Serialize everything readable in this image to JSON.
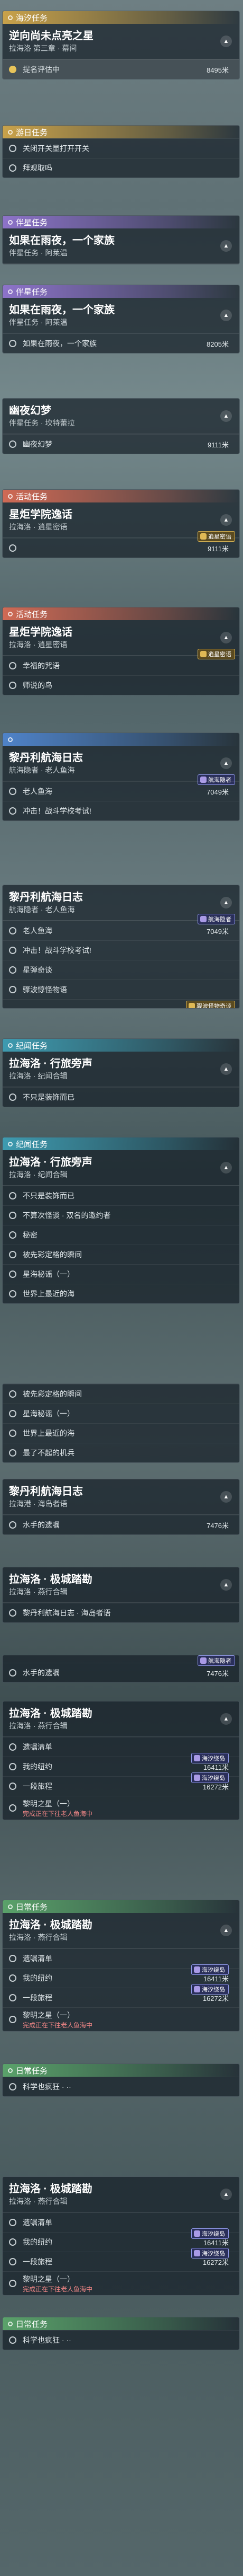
{
  "groups": [
    {
      "header": "海汐任务",
      "color": "yellow",
      "quest": {
        "title": "逆向尚未点亮之星",
        "subtitle": "拉海洛 第三章 · 幕间"
      },
      "rows": [
        {
          "text": "提名评估中",
          "distance": "8495米",
          "active": true,
          "checked": true
        }
      ]
    },
    {
      "header": "游日任务",
      "color": "yellow",
      "rows": [
        {
          "text": "关闭开关显打开开关"
        },
        {
          "text": "拜观取吗"
        }
      ]
    },
    {
      "header": "伴星任务",
      "color": "purple",
      "quest": {
        "title": "如果在雨夜，一个家族",
        "subtitle": "伴星任务 · 阿莱温"
      },
      "rows": []
    },
    {
      "header": "伴星任务",
      "color": "purple",
      "quest": {
        "title": "如果在雨夜，一个家族",
        "subtitle": "伴星任务 · 阿莱温"
      },
      "rows": [
        {
          "text": "如果在雨夜，一个家族",
          "distance": "8205米"
        }
      ]
    },
    {
      "quest": {
        "title": "幽夜幻梦",
        "subtitle": "伴星任务 · 坎特蕾拉"
      },
      "rows": [
        {
          "text": "幽夜幻梦",
          "distance": "9111米"
        }
      ]
    },
    {
      "header": "活动任务",
      "color": "red",
      "quest": {
        "title": "星炬学院逸话",
        "subtitle": "拉海洛 · 逍星密语"
      },
      "badge": {
        "text": "逍星密语",
        "style": "yellow"
      },
      "rows": [
        {
          "text": "",
          "distance": "9111米"
        }
      ]
    },
    {
      "header": "活动任务",
      "color": "red",
      "quest": {
        "title": "星炬学院逸话",
        "subtitle": "拉海洛 · 逍星密语"
      },
      "badge": {
        "text": "逍星密语",
        "style": "yellow"
      },
      "rows": [
        {
          "text": "幸福的咒语"
        },
        {
          "text": "师说的鸟"
        }
      ]
    },
    {
      "header": "",
      "color": "blue",
      "quest": {
        "title": "黎丹利航海日志",
        "subtitle": "航海隐者 · 老人鱼海"
      },
      "badge": {
        "text": "航海隐者",
        "style": "purple"
      },
      "rows": [
        {
          "text": "老人鱼海",
          "distance": "7049米"
        },
        {
          "text": "冲击！战斗学校考试!"
        }
      ]
    },
    {
      "quest": {
        "title": "黎丹利航海日志",
        "subtitle": "航海隐者 · 老人鱼海"
      },
      "badge": {
        "text": "航海隐者",
        "style": "purple"
      },
      "rows": [
        {
          "text": "老人鱼海",
          "distance": "7049米"
        },
        {
          "text": "冲击！战斗学校考试!"
        },
        {
          "text": "星弹奇谈"
        },
        {
          "text": "骤波惊怪物语"
        }
      ],
      "badge2": {
        "text": "骤波怪物奇谈",
        "style": "yellow"
      }
    },
    {
      "header": "纪闻任务",
      "color": "teal",
      "quest": {
        "title": "拉海洛 · 行旅旁声",
        "subtitle": "拉海洛 · 纪闻合辑"
      },
      "rows": [
        {
          "text": "不只是装饰而已"
        }
      ]
    },
    {
      "header": "纪闻任务",
      "color": "teal",
      "quest": {
        "title": "拉海洛 · 行旅旁声",
        "subtitle": "拉海洛 · 纪闻合辑"
      },
      "rows": [
        {
          "text": "不只是装饰而已"
        },
        {
          "text": "不算次怪谈 · 双名的邀约者"
        },
        {
          "text": "秘密"
        },
        {
          "text": "被先彩定格的瞬间"
        },
        {
          "text": "星海秘谣（一）"
        },
        {
          "text": "世界上最近的海"
        }
      ]
    },
    {
      "rows": [
        {
          "text": "被先彩定格的瞬间"
        },
        {
          "text": "星海秘谣（一）"
        },
        {
          "text": "世界上最近的海"
        },
        {
          "text": "最了不起的机兵"
        }
      ]
    },
    {
      "quest": {
        "title": "黎丹利航海日志",
        "subtitle": "拉海港 · 海岛者语"
      },
      "rows": [
        {
          "text": "水手的遗嘱",
          "distance": "7476米"
        }
      ]
    },
    {
      "quest": {
        "title": "拉海洛 · 极城踏勘",
        "subtitle": "拉海洛 · 燕行合辑"
      },
      "rows": [
        {
          "text": "黎丹利航海日志 · 海岛者语"
        }
      ]
    },
    {
      "badge": {
        "text": "航海隐者",
        "style": "purple"
      },
      "rows": [
        {
          "text": "水手的遗嘱",
          "distance": "7476米"
        }
      ]
    },
    {
      "quest": {
        "title": "拉海洛 · 极城踏勘",
        "subtitle": "拉海洛 · 燕行合辑"
      },
      "rows": [
        {
          "text": "遗嘱清单"
        },
        {
          "text": "我的纽约",
          "distance": "16411米",
          "badge": "海汐绕岛"
        },
        {
          "text": "一段旅程",
          "distance": "16272米",
          "badge": "海汐绕岛"
        },
        {
          "text": "黎明之星（一）",
          "warn": "完成正在下往老人鱼海中",
          "tall": true
        }
      ]
    },
    {
      "header": "日常任务",
      "color": "green",
      "quest": {
        "title": "拉海洛 · 极城踏勘",
        "subtitle": "拉海洛 · 燕行合辑"
      },
      "rows": [
        {
          "text": "遗嘱清单"
        },
        {
          "text": "我的纽约",
          "distance": "16411米",
          "badge": "海汐绕岛"
        },
        {
          "text": "一段旅程",
          "distance": "16272米",
          "badge": "海汐绕岛"
        },
        {
          "text": "黎明之星（一）",
          "warn": "完成正在下往老人鱼海中",
          "tall": true
        }
      ]
    },
    {
      "header": "日常任务",
      "color": "green",
      "rows": [
        {
          "text": "科学也疯狂 · ··"
        }
      ]
    },
    {
      "quest": {
        "title": "拉海洛 · 极城踏勘",
        "subtitle": "拉海洛 · 燕行合辑"
      },
      "rows": [
        {
          "text": "遗嘱清单"
        },
        {
          "text": "我的纽约",
          "distance": "16411米",
          "badge": "海汐绕岛"
        },
        {
          "text": "一段旅程",
          "distance": "16272米",
          "badge": "海汐绕岛"
        },
        {
          "text": "黎明之星（一）",
          "warn": "完成正在下往老人鱼海中",
          "tall": true
        }
      ]
    },
    {
      "header": "日常任务",
      "color": "green",
      "rows": [
        {
          "text": "科学也疯狂 · ··"
        }
      ]
    }
  ],
  "icons": {
    "chevron": "chevron-up-icon",
    "radio": "radio-circle-icon"
  }
}
